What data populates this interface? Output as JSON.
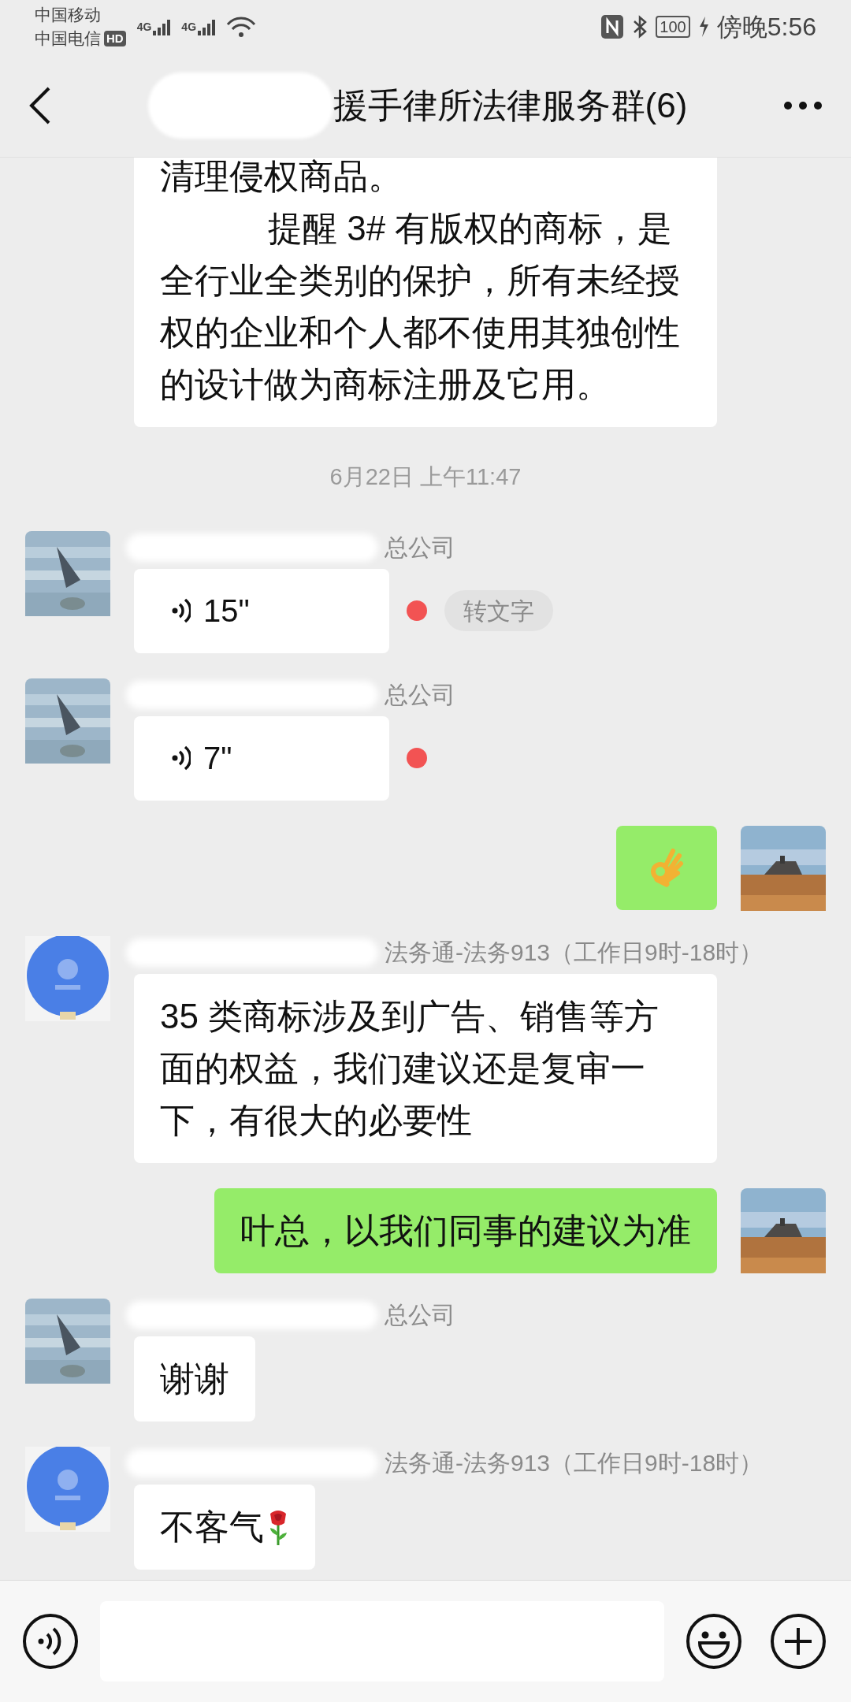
{
  "status_bar": {
    "carriers": [
      "中国移动",
      "中国电信"
    ],
    "hd_badge": "HD",
    "networks": [
      "4G",
      "4G"
    ],
    "battery": "100",
    "time": "傍晚5:56"
  },
  "header": {
    "title": "援手律所法律服务群(6)"
  },
  "messages": [
    {
      "kind": "text",
      "outgoing": false,
      "paragraphs": [
        {
          "text": "清理侵权商品。",
          "indented": false
        },
        {
          "text": "提醒 3# 有版权的商标，是全行业全类别的保护，所有未经授权的企业和个人都不使用其独创性的设计做为商标注册及它用。",
          "indented": true
        }
      ]
    },
    {
      "kind": "timestamp",
      "text": "6月22日 上午11:47"
    },
    {
      "kind": "voice",
      "outgoing": false,
      "avatar": {
        "kind": "sea_photo"
      },
      "sender": "总公司",
      "duration": "15\"",
      "unread": true,
      "convert_label": "转文字"
    },
    {
      "kind": "voice",
      "outgoing": false,
      "avatar": {
        "kind": "sea_photo"
      },
      "sender": "总公司",
      "duration": "7\"",
      "unread": true
    },
    {
      "kind": "emoji",
      "outgoing": true,
      "avatar": {
        "kind": "field_photo"
      },
      "emoji": {
        "kind": "ok_hand"
      }
    },
    {
      "kind": "text",
      "outgoing": false,
      "avatar": {
        "kind": "logo"
      },
      "sender": "法务通-法务913（工作日9时-18时）",
      "paragraphs": [
        {
          "text": "35 类商标涉及到广告、销售等方面的权益，我们建议还是复审一下，有很大的必要性",
          "indented": false
        }
      ]
    },
    {
      "kind": "text",
      "outgoing": true,
      "avatar": {
        "kind": "field_photo"
      },
      "paragraphs": [
        {
          "text": "叶总，以我们同事的建议为准",
          "indented": false
        }
      ]
    },
    {
      "kind": "text",
      "outgoing": false,
      "avatar": {
        "kind": "sea_photo"
      },
      "sender": "总公司",
      "paragraphs": [
        {
          "text": "谢谢",
          "indented": false
        }
      ]
    },
    {
      "kind": "text",
      "outgoing": false,
      "avatar": {
        "kind": "logo"
      },
      "sender": "法务通-法务913（工作日9时-18时）",
      "paragraphs": [
        {
          "text": "不客气",
          "indented": false
        }
      ],
      "trailing_emoji": {
        "kind": "rose"
      }
    }
  ]
}
